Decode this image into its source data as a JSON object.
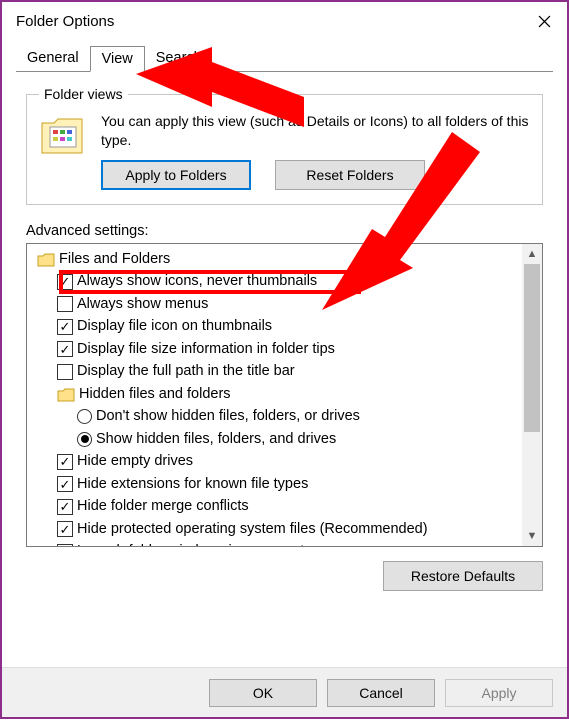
{
  "window": {
    "title": "Folder Options"
  },
  "tabs": {
    "general": "General",
    "view": "View",
    "search": "Search",
    "active": "view"
  },
  "folder_views": {
    "legend": "Folder views",
    "text": "You can apply this view (such as Details or Icons) to all folders of this type.",
    "apply_btn": "Apply to Folders",
    "reset_btn": "Reset Folders"
  },
  "advanced": {
    "label": "Advanced settings:",
    "root_label": "Files and Folders",
    "items": [
      {
        "type": "check",
        "checked": true,
        "label": "Always show icons, never thumbnails",
        "highlighted": true
      },
      {
        "type": "check",
        "checked": false,
        "label": "Always show menus"
      },
      {
        "type": "check",
        "checked": true,
        "label": "Display file icon on thumbnails"
      },
      {
        "type": "check",
        "checked": true,
        "label": "Display file size information in folder tips"
      },
      {
        "type": "check",
        "checked": false,
        "label": "Display the full path in the title bar"
      },
      {
        "type": "folder",
        "label": "Hidden files and folders",
        "children": [
          {
            "type": "radio",
            "selected": false,
            "label": "Don't show hidden files, folders, or drives"
          },
          {
            "type": "radio",
            "selected": true,
            "label": "Show hidden files, folders, and drives"
          }
        ]
      },
      {
        "type": "check",
        "checked": true,
        "label": "Hide empty drives"
      },
      {
        "type": "check",
        "checked": true,
        "label": "Hide extensions for known file types"
      },
      {
        "type": "check",
        "checked": true,
        "label": "Hide folder merge conflicts"
      },
      {
        "type": "check",
        "checked": true,
        "label": "Hide protected operating system files (Recommended)"
      },
      {
        "type": "check",
        "checked": false,
        "label": "Launch folder windows in a separate process"
      }
    ]
  },
  "restore_btn": "Restore Defaults",
  "dialog_buttons": {
    "ok": "OK",
    "cancel": "Cancel",
    "apply": "Apply"
  },
  "annotations": {
    "arrow1": "points to View tab",
    "arrow2": "points to first checkbox item"
  }
}
